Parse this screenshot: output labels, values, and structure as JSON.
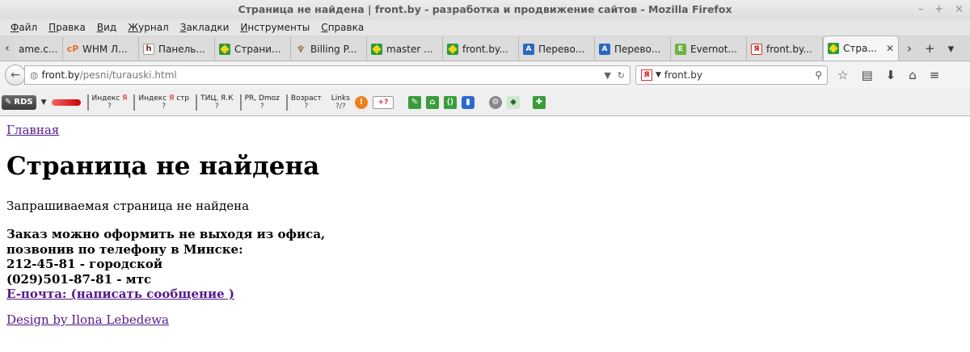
{
  "window": {
    "title": "Страница не найдена | front.by - разработка и продвижение сайтов - Mozilla Firefox",
    "controls": [
      "–",
      "+",
      "×"
    ]
  },
  "menu": [
    {
      "u": "Ф",
      "rest": "айл"
    },
    {
      "u": "П",
      "rest": "равка"
    },
    {
      "u": "В",
      "rest": "ид"
    },
    {
      "u": "Ж",
      "rest": "урнал"
    },
    {
      "u": "З",
      "rest": "акладки"
    },
    {
      "u": "И",
      "rest": "нструменты"
    },
    {
      "u": "С",
      "rest": "правка"
    }
  ],
  "tabs": [
    {
      "label": "ame.c...",
      "icon": "none"
    },
    {
      "label": "WHM Л...",
      "icon": "cpanel-icon"
    },
    {
      "label": "Панель...",
      "icon": "h-icon"
    },
    {
      "label": "Страни...",
      "icon": "brazil-flag-icon"
    },
    {
      "label": "Billing P...",
      "icon": "billing-icon"
    },
    {
      "label": "master ...",
      "icon": "brazil-flag-icon"
    },
    {
      "label": "front.by...",
      "icon": "brazil-flag-icon"
    },
    {
      "label": "Перево...",
      "icon": "translate-icon"
    },
    {
      "label": "Перево...",
      "icon": "translate-icon"
    },
    {
      "label": "Evernot...",
      "icon": "evernote-icon"
    },
    {
      "label": "front.by...",
      "icon": "yandex-icon"
    },
    {
      "label": "Стра...",
      "icon": "brazil-flag-icon",
      "active": true
    }
  ],
  "nav": {
    "url_host": "front.by",
    "url_path": "/pesni/turauski.html",
    "search_engine": "front.by"
  },
  "addons": {
    "rds": "RDS",
    "seo": [
      {
        "label": "Индекс",
        "mark": "Я",
        "q": "?"
      },
      {
        "label": "Индекс",
        "mark": "Я",
        "extra": "стр",
        "q": "?"
      },
      {
        "label": "ТИЦ, Я.К",
        "q": "?"
      },
      {
        "label": "PR, Dmoz",
        "q": "?"
      },
      {
        "label": "Возраст",
        "q": "?"
      },
      {
        "label": "Links",
        "q": "?/?"
      }
    ],
    "gplus": "+?"
  },
  "page": {
    "home_link": "Главная",
    "heading": "Страница не найдена",
    "lead": "Запрашиваемая страница не найдена",
    "order_line1": "Заказ можно оформить не выходя из офиса,",
    "order_line2": "позвонив по телефону в Минске:",
    "phone1": "212-45-81 - городской",
    "phone2": "(029)501-87-81 - мтс",
    "email_link": "E-почта: (написать сообщение )",
    "design": "Design by Ilona Lebedewa"
  }
}
